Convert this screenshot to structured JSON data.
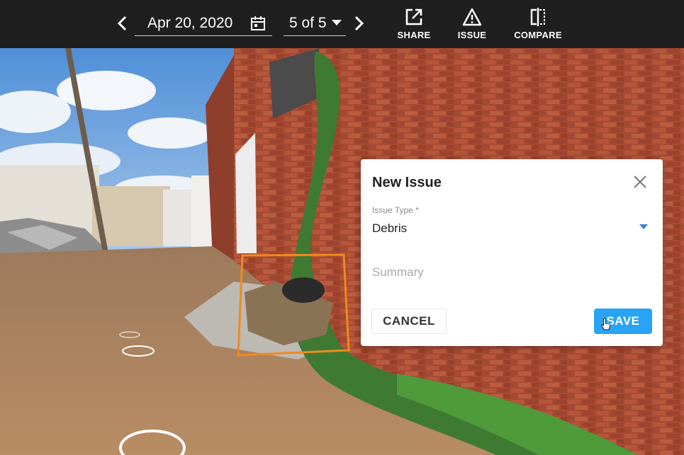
{
  "toolbar": {
    "date": "Apr 20, 2020",
    "page": "5 of 5",
    "share_label": "SHARE",
    "issue_label": "ISSUE",
    "compare_label": "COMPARE"
  },
  "icons": {
    "prev": "chevron-left-icon",
    "next": "chevron-right-icon",
    "calendar": "calendar-icon",
    "share": "share-external-icon",
    "issue": "warning-triangle-icon",
    "compare": "compare-split-icon",
    "close": "close-icon"
  },
  "dialog": {
    "title": "New Issue",
    "issue_type_label": "Issue Type *",
    "issue_type_value": "Debris",
    "summary_placeholder": "Summary",
    "cancel_label": "CANCEL",
    "save_label": "SAVE"
  },
  "colors": {
    "toolbar_bg": "#1f1f1f",
    "accent": "#29a3f5",
    "selection_box": "#f08a1c"
  }
}
